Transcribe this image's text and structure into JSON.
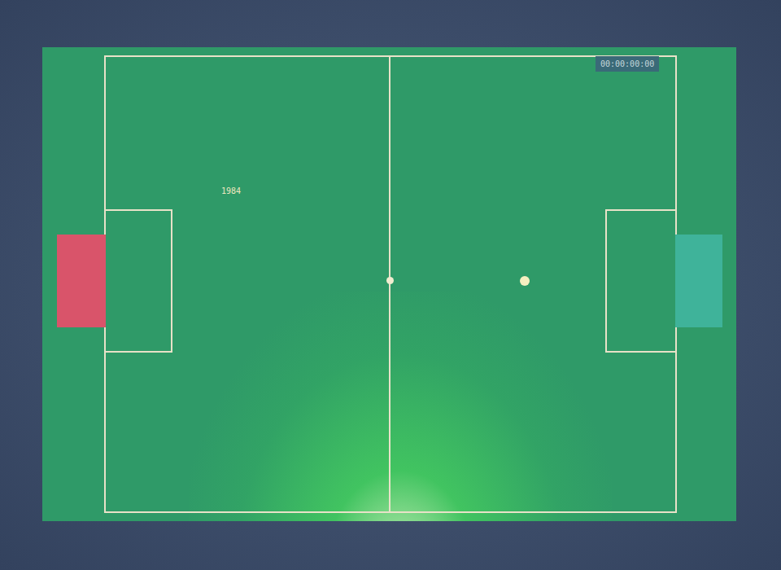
{
  "timer": "00:00:00:00",
  "label": "1984",
  "goals": [
    {
      "kind": "left",
      "color": "#d9546a"
    },
    {
      "kind": "right",
      "color": "#3fb39a"
    }
  ]
}
